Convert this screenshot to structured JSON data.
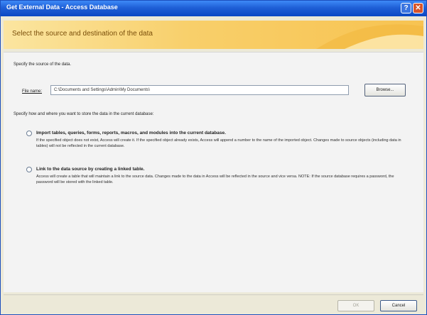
{
  "window": {
    "title": "Get External Data - Access Database",
    "help_glyph": "?",
    "close_glyph": "✕"
  },
  "banner": {
    "title": "Select the source and destination of the data"
  },
  "source": {
    "label": "Specify the source of the data.",
    "file_name_label": "File name:",
    "file_name_value": "C:\\Documents and Settings\\Admin\\My Documents\\",
    "browse_label": "Browse..."
  },
  "destination": {
    "label": "Specify how and where you want to store the data in the current database:"
  },
  "options": {
    "import": {
      "title": "Import tables, queries, forms, reports, macros, and modules into the current database.",
      "desc": "If the specified object does not exist, Access will create it. If the specified object already exists, Access will append a number to the name of the imported object. Changes made to source objects (including data in tables) will not be reflected in the current database."
    },
    "link": {
      "title": "Link to the data source by creating a linked table.",
      "desc": "Access will create a table that will maintain a link to the source data. Changes made to the data in Access will be reflected in the source and vice versa. NOTE: If the source database requires a password, the password will be stored with the linked table."
    }
  },
  "footer": {
    "ok_label": "OK",
    "cancel_label": "Cancel"
  }
}
